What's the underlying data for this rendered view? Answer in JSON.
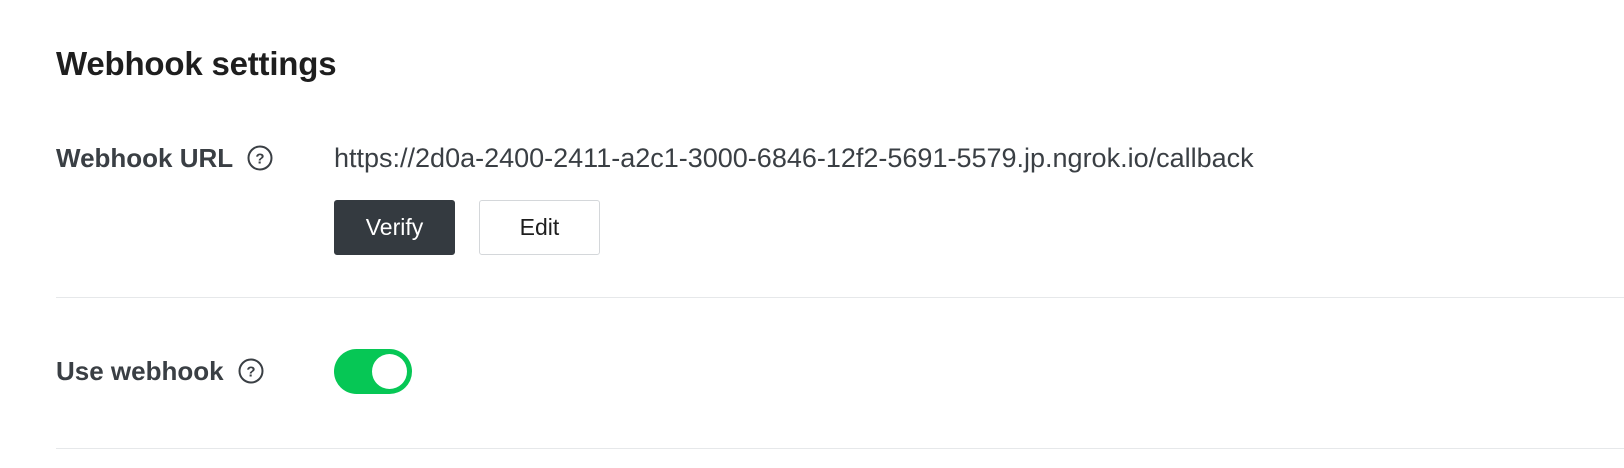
{
  "section": {
    "title": "Webhook settings"
  },
  "webhook_url": {
    "label": "Webhook URL",
    "help_icon": "question-circle-icon",
    "value": "https://2d0a-2400-2411-a2c1-3000-6846-12f2-5691-5579.jp.ngrok.io/callback",
    "verify_label": "Verify",
    "edit_label": "Edit"
  },
  "use_webhook": {
    "label": "Use webhook",
    "help_icon": "question-circle-icon",
    "enabled": true
  },
  "colors": {
    "toggle_on": "#06c755",
    "verify_button": "#343a40",
    "divider": "#e6e8ea",
    "label_text": "#3a3f44"
  }
}
